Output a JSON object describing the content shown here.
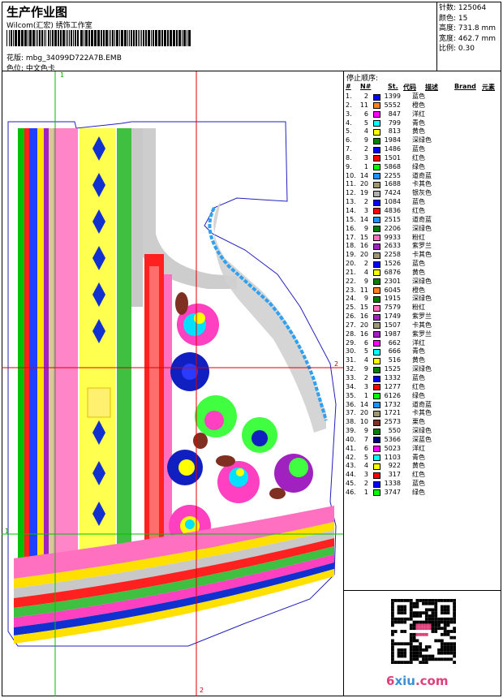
{
  "header": {
    "title": "生产作业图",
    "studio": "Wilcom(汇宏) 绣饰工作室",
    "file": "花版: mbg_34099D722A7B.EMB",
    "colorway": "色位: 中文色卡"
  },
  "stats": {
    "stitches": "针数: 125064",
    "colors": "颜色: 15",
    "height": "高度: 731.8 mm",
    "width": "宽度: 462.7 mm",
    "scale": "比例: 0.30"
  },
  "panel": {
    "title": "停止顺序:",
    "col_no": "#",
    "col_n": "N#",
    "col_st": "St.",
    "col_code": "代码",
    "col_desc": "描述",
    "col_brand": "Brand",
    "col_elem": "元素"
  },
  "stops": [
    {
      "no": "1.",
      "n": "2",
      "st": "1399",
      "desc": "蓝色",
      "color": "#0000ff"
    },
    {
      "no": "2.",
      "n": "11",
      "st": "5552",
      "desc": "橙色",
      "color": "#ff8020"
    },
    {
      "no": "3.",
      "n": "6",
      "st": "847",
      "desc": "洋红",
      "color": "#ff00ff"
    },
    {
      "no": "4.",
      "n": "5",
      "st": "799",
      "desc": "青色",
      "color": "#00ffff"
    },
    {
      "no": "5.",
      "n": "4",
      "st": "813",
      "desc": "黄色",
      "color": "#ffff00"
    },
    {
      "no": "6.",
      "n": "9",
      "st": "1984",
      "desc": "深绿色",
      "color": "#008000"
    },
    {
      "no": "7.",
      "n": "2",
      "st": "1486",
      "desc": "蓝色",
      "color": "#0000ff"
    },
    {
      "no": "8.",
      "n": "3",
      "st": "1501",
      "desc": "红色",
      "color": "#ff0000"
    },
    {
      "no": "9.",
      "n": "1",
      "st": "5868",
      "desc": "绿色",
      "color": "#00ff00"
    },
    {
      "no": "10.",
      "n": "14",
      "st": "2255",
      "desc": "道奇蓝",
      "color": "#1e90ff"
    },
    {
      "no": "11.",
      "n": "20",
      "st": "1688",
      "desc": "卡其色",
      "color": "#a09870"
    },
    {
      "no": "12.",
      "n": "19",
      "st": "7424",
      "desc": "银灰色",
      "color": "#b0b0b0"
    },
    {
      "no": "13.",
      "n": "2",
      "st": "1084",
      "desc": "蓝色",
      "color": "#0000ff"
    },
    {
      "no": "14.",
      "n": "3",
      "st": "4836",
      "desc": "红色",
      "color": "#ff0000"
    },
    {
      "no": "15.",
      "n": "14",
      "st": "2515",
      "desc": "道奇蓝",
      "color": "#1e90ff"
    },
    {
      "no": "16.",
      "n": "9",
      "st": "2206",
      "desc": "深绿色",
      "color": "#008000"
    },
    {
      "no": "17.",
      "n": "15",
      "st": "9933",
      "desc": "粉红",
      "color": "#ff70c0"
    },
    {
      "no": "18.",
      "n": "16",
      "st": "2633",
      "desc": "紫罗兰",
      "color": "#a020c0"
    },
    {
      "no": "19.",
      "n": "20",
      "st": "2258",
      "desc": "卡其色",
      "color": "#a09870"
    },
    {
      "no": "20.",
      "n": "2",
      "st": "1526",
      "desc": "蓝色",
      "color": "#0000ff"
    },
    {
      "no": "21.",
      "n": "4",
      "st": "6876",
      "desc": "黄色",
      "color": "#ffff00"
    },
    {
      "no": "22.",
      "n": "9",
      "st": "2301",
      "desc": "深绿色",
      "color": "#008000"
    },
    {
      "no": "23.",
      "n": "11",
      "st": "6045",
      "desc": "橙色",
      "color": "#ff8020"
    },
    {
      "no": "24.",
      "n": "9",
      "st": "1915",
      "desc": "深绿色",
      "color": "#008000"
    },
    {
      "no": "25.",
      "n": "15",
      "st": "7579",
      "desc": "粉红",
      "color": "#ff70c0"
    },
    {
      "no": "26.",
      "n": "16",
      "st": "1749",
      "desc": "紫罗兰",
      "color": "#a020c0"
    },
    {
      "no": "27.",
      "n": "20",
      "st": "1507",
      "desc": "卡其色",
      "color": "#a09870"
    },
    {
      "no": "28.",
      "n": "16",
      "st": "1987",
      "desc": "紫罗兰",
      "color": "#a020c0"
    },
    {
      "no": "29.",
      "n": "6",
      "st": "662",
      "desc": "洋红",
      "color": "#ff00ff"
    },
    {
      "no": "30.",
      "n": "5",
      "st": "666",
      "desc": "青色",
      "color": "#00ffff"
    },
    {
      "no": "31.",
      "n": "4",
      "st": "516",
      "desc": "黄色",
      "color": "#ffff00"
    },
    {
      "no": "32.",
      "n": "9",
      "st": "1525",
      "desc": "深绿色",
      "color": "#008000"
    },
    {
      "no": "33.",
      "n": "2",
      "st": "1332",
      "desc": "蓝色",
      "color": "#0000ff"
    },
    {
      "no": "34.",
      "n": "3",
      "st": "1277",
      "desc": "红色",
      "color": "#ff0000"
    },
    {
      "no": "35.",
      "n": "1",
      "st": "6126",
      "desc": "绿色",
      "color": "#00ff00"
    },
    {
      "no": "36.",
      "n": "14",
      "st": "1732",
      "desc": "道奇蓝",
      "color": "#1e90ff"
    },
    {
      "no": "37.",
      "n": "20",
      "st": "1721",
      "desc": "卡其色",
      "color": "#a09870"
    },
    {
      "no": "38.",
      "n": "10",
      "st": "2573",
      "desc": "栗色",
      "color": "#803020"
    },
    {
      "no": "39.",
      "n": "9",
      "st": "550",
      "desc": "深绿色",
      "color": "#008000"
    },
    {
      "no": "40.",
      "n": "7",
      "st": "5366",
      "desc": "深蓝色",
      "color": "#000080"
    },
    {
      "no": "41.",
      "n": "6",
      "st": "5023",
      "desc": "洋红",
      "color": "#ff00ff"
    },
    {
      "no": "42.",
      "n": "5",
      "st": "1103",
      "desc": "青色",
      "color": "#00ffff"
    },
    {
      "no": "43.",
      "n": "4",
      "st": "922",
      "desc": "黄色",
      "color": "#ffff00"
    },
    {
      "no": "44.",
      "n": "3",
      "st": "317",
      "desc": "红色",
      "color": "#ff0000"
    },
    {
      "no": "45.",
      "n": "2",
      "st": "1338",
      "desc": "蓝色",
      "color": "#0000ff"
    },
    {
      "no": "46.",
      "n": "1",
      "st": "3747",
      "desc": "绿色",
      "color": "#00ff00"
    }
  ],
  "guides": {
    "label_1": "1",
    "label_2": "2"
  },
  "watermark": {
    "a": "6",
    "b": "xiu",
    "c": ".com"
  },
  "colors": {
    "guide_red": "#e00000",
    "guide_green": "#00c000",
    "outline_blue": "#2020c0"
  }
}
